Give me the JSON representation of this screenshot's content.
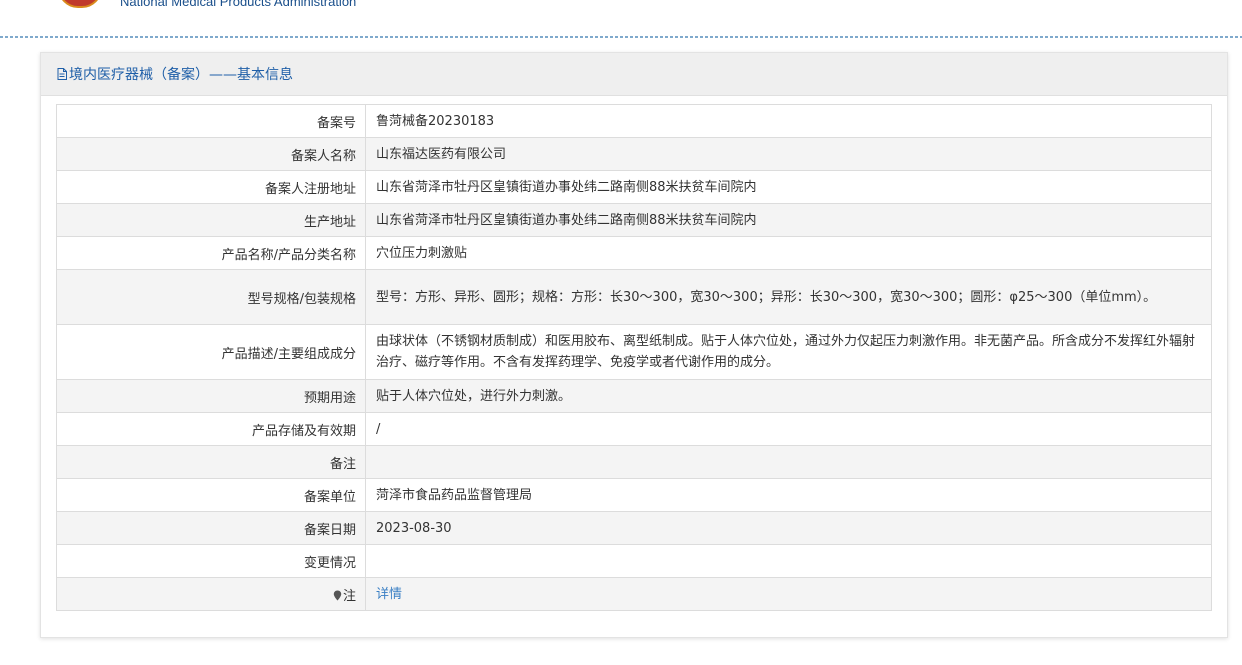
{
  "header": {
    "agency_name_en": "National Medical Products Administration",
    "logo_icon": "nmpa-emblem-icon",
    "accent_color": "#1a4f8b"
  },
  "panel": {
    "title": "境内医疗器械（备案）——基本信息",
    "title_icon": "document-icon",
    "title_color": "#1f5fa8"
  },
  "rows": [
    {
      "label": "备案号",
      "value": "鲁菏械备20230183"
    },
    {
      "label": "备案人名称",
      "value": "山东福达医药有限公司"
    },
    {
      "label": "备案人注册地址",
      "value": "山东省菏泽市牡丹区皇镇街道办事处纬二路南侧88米扶贫车间院内"
    },
    {
      "label": "生产地址",
      "value": "山东省菏泽市牡丹区皇镇街道办事处纬二路南侧88米扶贫车间院内"
    },
    {
      "label": "产品名称/产品分类名称",
      "value": "穴位压力刺激贴"
    },
    {
      "label": "型号规格/包装规格",
      "value": "型号：方形、异形、圆形；规格：方形：长30～300，宽30～300；异形：长30～300，宽30～300；圆形：φ25～300（单位mm）。"
    },
    {
      "label": "产品描述/主要组成成分",
      "value": "由球状体（不锈钢材质制成）和医用胶布、离型纸制成。贴于人体穴位处，通过外力仅起压力刺激作用。非无菌产品。所含成分不发挥红外辐射治疗、磁疗等作用。不含有发挥药理学、免疫学或者代谢作用的成分。"
    },
    {
      "label": "预期用途",
      "value": "贴于人体穴位处，进行外力刺激。"
    },
    {
      "label": "产品存储及有效期",
      "value": "/"
    },
    {
      "label": "备注",
      "value": ""
    },
    {
      "label": "备案单位",
      "value": "菏泽市食品药品监督管理局"
    },
    {
      "label": "备案日期",
      "value": "2023-08-30"
    },
    {
      "label": "变更情况",
      "value": ""
    },
    {
      "label": "注",
      "label_icon": "pin-icon",
      "value": "详情"
    }
  ]
}
